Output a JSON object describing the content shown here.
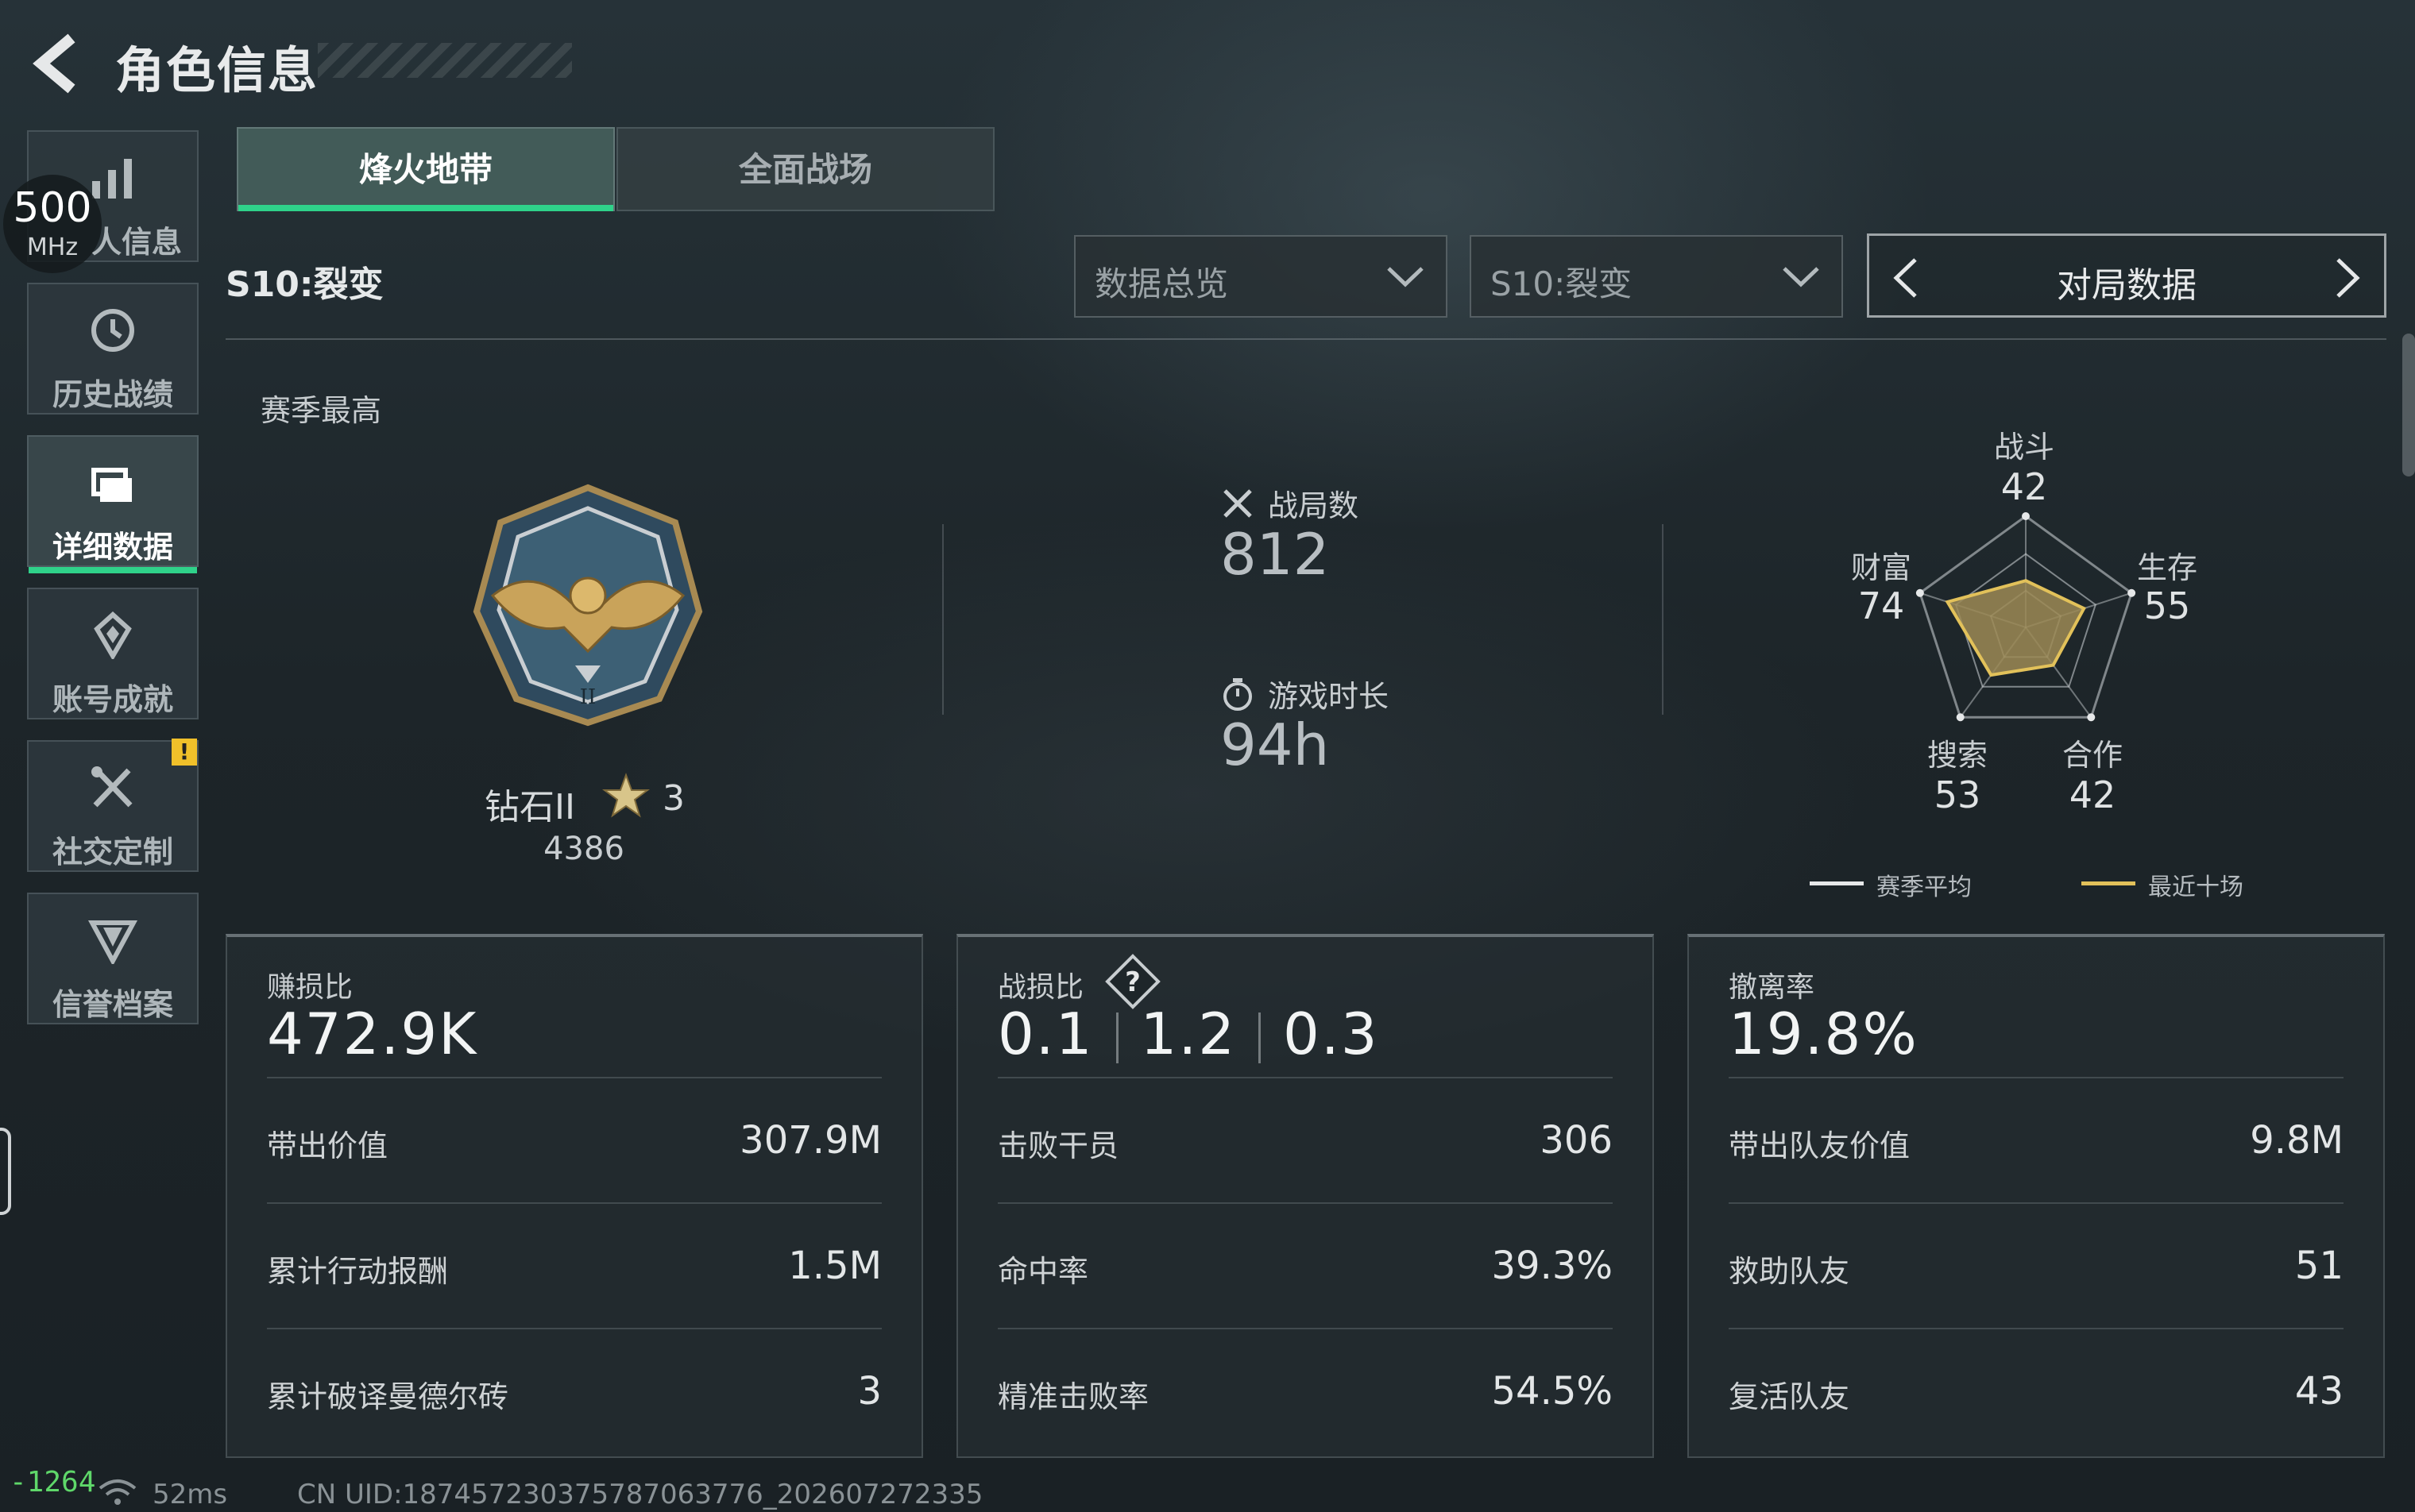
{
  "header": {
    "title": "角色信息",
    "back_icon": "back-arrow-icon"
  },
  "overlay": {
    "mhz_value": "500",
    "mhz_unit": "MHz"
  },
  "sidebar": {
    "items": [
      {
        "label": "人信息",
        "icon": "bar-chart-icon",
        "active": false
      },
      {
        "label": "历史战绩",
        "icon": "clock-history-icon",
        "active": false
      },
      {
        "label": "详细数据",
        "icon": "folder-icon",
        "active": true
      },
      {
        "label": "账号成就",
        "icon": "achievement-icon",
        "active": false
      },
      {
        "label": "社交定制",
        "icon": "tools-icon",
        "active": false,
        "badge": "!"
      },
      {
        "label": "信誉档案",
        "icon": "shield-emblem-icon",
        "active": false
      }
    ]
  },
  "tabs": [
    {
      "label": "烽火地带",
      "active": true
    },
    {
      "label": "全面战场",
      "active": false
    }
  ],
  "season": {
    "label": "S10:裂变",
    "dropdown_view": "数据总览",
    "dropdown_season": "S10:裂变",
    "match_selector": "对局数据"
  },
  "rank": {
    "caption": "赛季最高",
    "tier": "钻石II",
    "stars": "3",
    "points": "4386"
  },
  "overview": {
    "matches_label": "战局数",
    "matches_value": "812",
    "playtime_label": "游戏时长",
    "playtime_value": "94h"
  },
  "radar": {
    "axes": [
      {
        "label": "战斗",
        "value": "42"
      },
      {
        "label": "生存",
        "value": "55"
      },
      {
        "label": "合作",
        "value": "42"
      },
      {
        "label": "搜索",
        "value": "53"
      },
      {
        "label": "财富",
        "value": "74"
      }
    ],
    "series_values": [
      42,
      55,
      42,
      53,
      74
    ],
    "max": 100,
    "legend": [
      {
        "label": "赛季平均",
        "color": "#e6e8e9"
      },
      {
        "label": "最近十场",
        "color": "#e2c15a"
      }
    ],
    "fill_color": "#9c8a55"
  },
  "cards": [
    {
      "title": "赚损比",
      "main": "472.9K",
      "rows": [
        {
          "key": "带出价值",
          "value": "307.9M"
        },
        {
          "key": "累计行动报酬",
          "value": "1.5M"
        },
        {
          "key": "累计破译曼德尔砖",
          "value": "3"
        }
      ]
    },
    {
      "title": "战损比",
      "help": "?",
      "ratios": [
        "0.1",
        "1.2",
        "0.3"
      ],
      "rows": [
        {
          "key": "击败干员",
          "value": "306"
        },
        {
          "key": "命中率",
          "value": "39.3%"
        },
        {
          "key": "精准击败率",
          "value": "54.5%"
        }
      ]
    },
    {
      "title": "撤离率",
      "main": "19.8%",
      "rows": [
        {
          "key": "带出队友价值",
          "value": "9.8M"
        },
        {
          "key": "救助队友",
          "value": "51"
        },
        {
          "key": "复活队友",
          "value": "43"
        }
      ]
    }
  ],
  "footer": {
    "fps": "-1264",
    "ping": "52ms",
    "uid": "CN UID:1874572303757870637​76_202607272335"
  },
  "colors": {
    "accent": "#2fd28a",
    "warning": "#f0c02a",
    "gold": "#e2c15a"
  }
}
